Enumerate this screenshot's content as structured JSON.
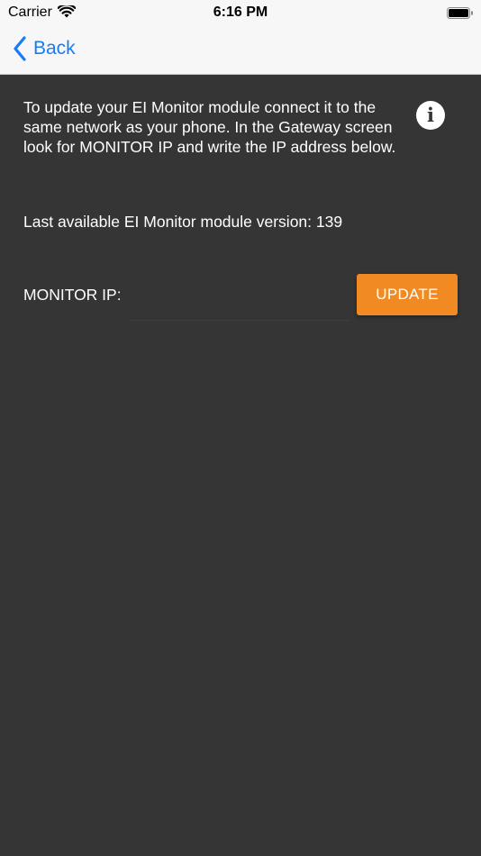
{
  "status_bar": {
    "carrier": "Carrier",
    "time": "6:16 PM",
    "wifi_icon": "wifi-icon",
    "battery_icon": "battery-icon"
  },
  "nav": {
    "back_label": "Back",
    "back_icon": "chevron-left-icon"
  },
  "content": {
    "description": "To update your EI Monitor module connect it to the same network as your phone. In the Gateway screen look for MONITOR IP and write the IP address below.",
    "info_icon": "info-icon",
    "info_glyph": "i",
    "version_text": "Last available EI Monitor module version: 139",
    "ip_label": "MONITOR IP:",
    "ip_value": "",
    "ip_placeholder": "",
    "update_label": "UPDATE"
  },
  "colors": {
    "background": "#353535",
    "header_background": "#f7f7f7",
    "accent_blue": "#1a7cf5",
    "update_button": "#f28a24",
    "text": "#ffffff"
  }
}
